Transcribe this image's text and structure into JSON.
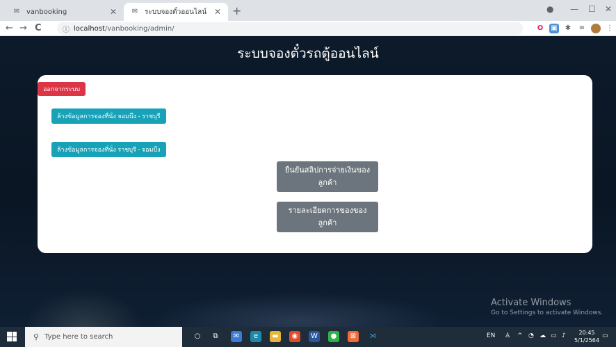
{
  "browser": {
    "tabs": [
      {
        "label": "vanbooking",
        "icon": "site-icon"
      },
      {
        "label": "ระบบจองตั๋วออนไลน์",
        "icon": "site-icon"
      }
    ],
    "new_tab_symbol": "+",
    "window_controls": {
      "minimize": "—",
      "maximize": "☐",
      "close": "✕"
    },
    "url_host": "localhost",
    "url_path": "/vanbooking/admin/",
    "nav": {
      "back": "←",
      "forward": "→",
      "reload": "C"
    }
  },
  "page": {
    "title": "ระบบจองตั๋วรถตู้ออนไลน์",
    "logout_button": "ออกจากระบบ",
    "clear_buttons": [
      "ล้างข้อมูลการจองที่นั่ง จอมบึง - ราชบุรี",
      "ล้างข้อมูลการจองที่นั่ง ราชบุรี - จอมบึง"
    ],
    "action_buttons": [
      "ยืนยันสลิปการจ่ายเงินของลูกค้า",
      "รายละเอียดการของของลูกค้า"
    ],
    "colors": {
      "danger": "#dc3545",
      "info": "#17a2b8",
      "secondary": "#6c757d"
    }
  },
  "watermark": {
    "line1": "Activate Windows",
    "line2": "Go to Settings to activate Windows."
  },
  "taskbar": {
    "search_placeholder": "Type here to search",
    "lang": "EN",
    "time": "20:45",
    "date": "5/1/2564"
  }
}
